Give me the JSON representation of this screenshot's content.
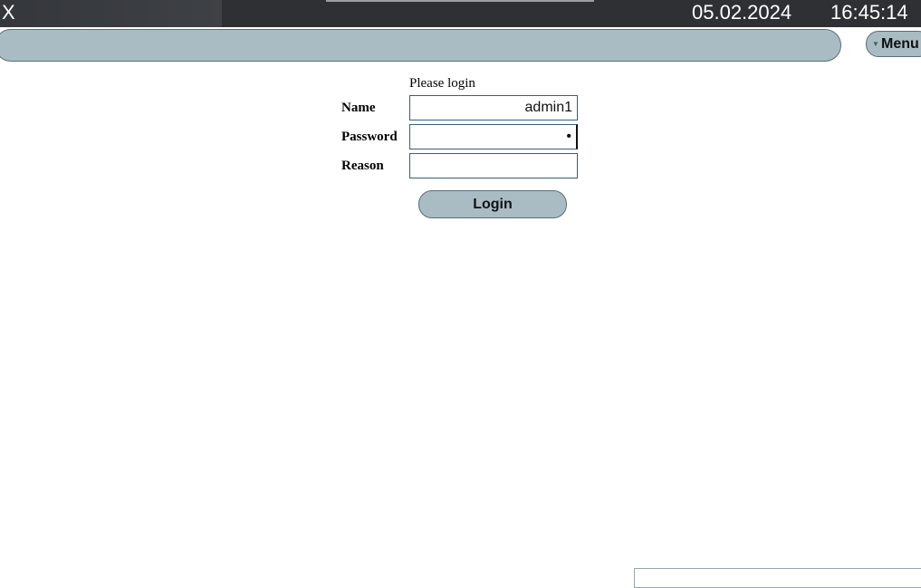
{
  "topbar": {
    "close_glyph": "X",
    "date": "05.02.2024",
    "time": "16:45:14"
  },
  "header": {
    "menu_label": "Menu",
    "menu_icon": "caret-down-icon"
  },
  "login_form": {
    "prompt": "Please login",
    "name_label": "Name",
    "name_value": "admin1",
    "password_label": "Password",
    "password_value": "•",
    "reason_label": "Reason",
    "reason_value": "",
    "login_button": "Login"
  },
  "colors": {
    "topbar_bg": "#2e3033",
    "pill_bg": "#a9bcc3",
    "field_border": "#365f7a"
  }
}
